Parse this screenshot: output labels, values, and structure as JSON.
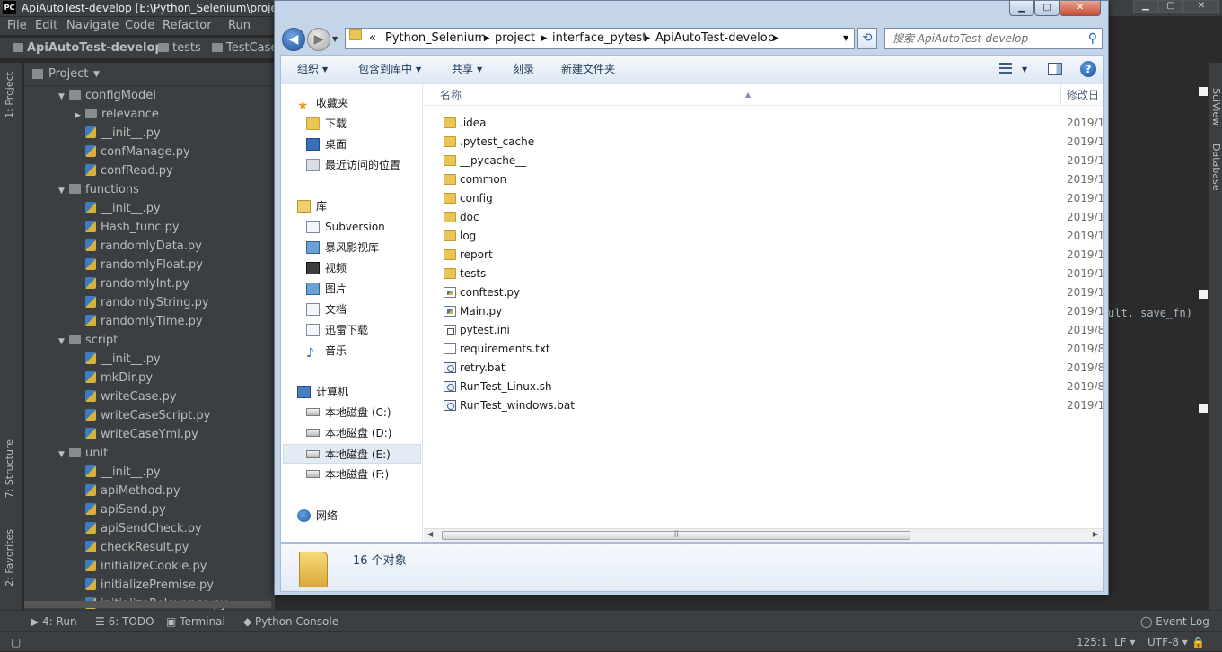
{
  "ide": {
    "window_title": "ApiAutoTest-develop [E:\\Python_Selenium\\proje",
    "logo_text": "PC",
    "menu": [
      "File",
      "Edit",
      "Navigate",
      "Code",
      "Refactor",
      "Run"
    ],
    "breadcrumb": [
      "ApiAutoTest-develop",
      "tests",
      "TestCase"
    ],
    "left_tabs": [
      "1: Project",
      "7: Structure",
      "2: Favorites"
    ],
    "project_panel_title": "Project",
    "tree": [
      {
        "label": "configModel",
        "type": "folder",
        "level": 1,
        "expanded": true
      },
      {
        "label": "relevance",
        "type": "folder",
        "level": 2,
        "expanded": false
      },
      {
        "label": "__init__.py",
        "type": "py",
        "level": 2
      },
      {
        "label": "confManage.py",
        "type": "py",
        "level": 2
      },
      {
        "label": "confRead.py",
        "type": "py",
        "level": 2
      },
      {
        "label": "functions",
        "type": "folder",
        "level": 1,
        "expanded": true
      },
      {
        "label": "__init__.py",
        "type": "py",
        "level": 2
      },
      {
        "label": "Hash_func.py",
        "type": "py",
        "level": 2
      },
      {
        "label": "randomlyData.py",
        "type": "py",
        "level": 2
      },
      {
        "label": "randomlyFloat.py",
        "type": "py",
        "level": 2
      },
      {
        "label": "randomlyInt.py",
        "type": "py",
        "level": 2
      },
      {
        "label": "randomlyString.py",
        "type": "py",
        "level": 2
      },
      {
        "label": "randomlyTime.py",
        "type": "py",
        "level": 2
      },
      {
        "label": "script",
        "type": "folder",
        "level": 1,
        "expanded": true
      },
      {
        "label": "__init__.py",
        "type": "py",
        "level": 2
      },
      {
        "label": "mkDir.py",
        "type": "py",
        "level": 2
      },
      {
        "label": "writeCase.py",
        "type": "py",
        "level": 2
      },
      {
        "label": "writeCaseScript.py",
        "type": "py",
        "level": 2
      },
      {
        "label": "writeCaseYml.py",
        "type": "py",
        "level": 2
      },
      {
        "label": "unit",
        "type": "folder",
        "level": 1,
        "expanded": true
      },
      {
        "label": "__init__.py",
        "type": "py",
        "level": 2
      },
      {
        "label": "apiMethod.py",
        "type": "py",
        "level": 2
      },
      {
        "label": "apiSend.py",
        "type": "py",
        "level": 2
      },
      {
        "label": "apiSendCheck.py",
        "type": "py",
        "level": 2
      },
      {
        "label": "checkResult.py",
        "type": "py",
        "level": 2
      },
      {
        "label": "initializeCookie.py",
        "type": "py",
        "level": 2
      },
      {
        "label": "initializePremise.py",
        "type": "py",
        "level": 2
      },
      {
        "label": "initializeRelevance.py",
        "type": "py",
        "level": 2
      }
    ],
    "editor_code_fragment": "ult, save_fn)",
    "right_tabs": [
      "SciView",
      "Database"
    ],
    "tool_windows": [
      "4: Run",
      "6: TODO",
      "Terminal",
      "Python Console"
    ],
    "event_log": "Event Log",
    "status": {
      "position": "125:1",
      "line_sep": "LF",
      "encoding": "UTF-8"
    }
  },
  "explorer": {
    "address_path": [
      "«",
      "Python_Selenium",
      "project",
      "interface_pytest",
      "ApiAutoTest-develop"
    ],
    "search_placeholder": "搜索 ApiAutoTest-develop",
    "commands": [
      "组织",
      "包含到库中",
      "共享",
      "刻录",
      "新建文件夹"
    ],
    "favorites_header": "收藏夹",
    "favorites": [
      "下载",
      "桌面",
      "最近访问的位置"
    ],
    "libraries_header": "库",
    "libraries": [
      "Subversion",
      "暴风影视库",
      "视频",
      "图片",
      "文档",
      "迅雷下载",
      "音乐"
    ],
    "computer_header": "计算机",
    "drives": [
      "本地磁盘 (C:)",
      "本地磁盘 (D:)",
      "本地磁盘 (E:)",
      "本地磁盘 (F:)"
    ],
    "selected_drive": "本地磁盘 (E:)",
    "network_header": "网络",
    "columns": {
      "name": "名称",
      "modified": "修改日"
    },
    "files": [
      {
        "name": ".idea",
        "type": "folder",
        "date": "2019/1"
      },
      {
        "name": ".pytest_cache",
        "type": "folder",
        "date": "2019/1"
      },
      {
        "name": "__pycache__",
        "type": "folder",
        "date": "2019/1"
      },
      {
        "name": "common",
        "type": "folder",
        "date": "2019/1"
      },
      {
        "name": "config",
        "type": "folder",
        "date": "2019/1"
      },
      {
        "name": "doc",
        "type": "folder",
        "date": "2019/1"
      },
      {
        "name": "log",
        "type": "folder",
        "date": "2019/1"
      },
      {
        "name": "report",
        "type": "folder",
        "date": "2019/1"
      },
      {
        "name": "tests",
        "type": "folder",
        "date": "2019/1"
      },
      {
        "name": "conftest.py",
        "type": "py",
        "date": "2019/1"
      },
      {
        "name": "Main.py",
        "type": "py",
        "date": "2019/1"
      },
      {
        "name": "pytest.ini",
        "type": "ini",
        "date": "2019/8"
      },
      {
        "name": "requirements.txt",
        "type": "txt",
        "date": "2019/8"
      },
      {
        "name": "retry.bat",
        "type": "bat",
        "date": "2019/8"
      },
      {
        "name": "RunTest_Linux.sh",
        "type": "bat",
        "date": "2019/8"
      },
      {
        "name": "RunTest_windows.bat",
        "type": "bat",
        "date": "2019/1"
      }
    ],
    "object_count": "16 个对象"
  }
}
